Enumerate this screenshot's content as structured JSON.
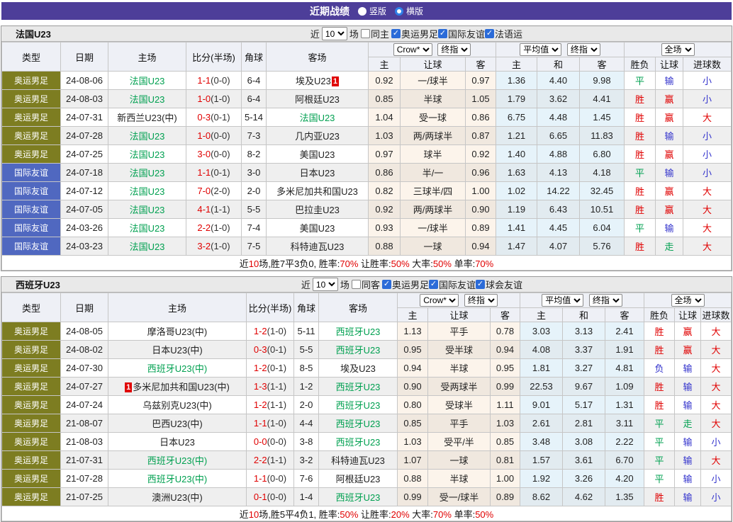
{
  "topbar": {
    "title": "近期战绩",
    "radios": [
      {
        "label": "竖版",
        "selected": false
      },
      {
        "label": "横版",
        "selected": true
      }
    ]
  },
  "colors": {
    "accent_purple": "#4d3e99",
    "red": "#e00000",
    "green": "#00a050",
    "blue": "#3333cc",
    "olive_type_badge": "#7d7d21",
    "blue_type_badge": "#5068c0",
    "header_bg": "#eef0f6",
    "section_title_bg": "#e9e9e9",
    "alt_row_bg": "#efefef",
    "odds_col_tint": "#faf0e6",
    "avg_col_tint": "#e7f2f9",
    "red_card_badge": "#e00000"
  },
  "sections": [
    {
      "team": "法国U23",
      "controls": {
        "near": "近",
        "count": "10",
        "unit": "场",
        "same": {
          "label": "同主",
          "checked": false
        },
        "filters": [
          {
            "label": "奥运男足",
            "checked": true
          },
          {
            "label": "国际友谊",
            "checked": true
          },
          {
            "label": "法语运",
            "checked": true
          }
        ]
      },
      "header": {
        "left_cols": [
          "类型",
          "日期",
          "主场",
          "比分(半场)",
          "角球",
          "客场"
        ],
        "odds_select": "Crow*",
        "odds_final_select": "终指",
        "odds_cols": [
          "主",
          "让球",
          "客"
        ],
        "avg_select": "平均值",
        "avg_final_select": "终指",
        "avg_cols": [
          "主",
          "和",
          "客"
        ],
        "full_select": "全场",
        "full_cols": [
          "胜负",
          "让球",
          "进球数"
        ]
      },
      "rows": [
        {
          "type": "奥运男足",
          "tc": "olive",
          "date": "24-08-06",
          "home": "法国U23",
          "hg": true,
          "hb": "",
          "score": "1-1",
          "half": "(0-0)",
          "corner": "6-4",
          "away": "埃及U23",
          "ag": false,
          "ab": "1",
          "o1": "0.92",
          "hc": "一/球半",
          "o2": "0.97",
          "a1": "1.36",
          "a2": "4.40",
          "a3": "9.98",
          "rs": "平",
          "rsc": "g",
          "hr": "输",
          "hrc": "b",
          "gl": "小",
          "glc": "b"
        },
        {
          "type": "奥运男足",
          "tc": "olive",
          "date": "24-08-03",
          "home": "法国U23",
          "hg": true,
          "hb": "",
          "score": "1-0",
          "half": "(1-0)",
          "corner": "6-4",
          "away": "阿根廷U23",
          "ag": false,
          "ab": "",
          "o1": "0.85",
          "hc": "半球",
          "o2": "1.05",
          "a1": "1.79",
          "a2": "3.62",
          "a3": "4.41",
          "rs": "胜",
          "rsc": "r",
          "hr": "赢",
          "hrc": "r",
          "gl": "小",
          "glc": "b"
        },
        {
          "type": "奥运男足",
          "tc": "olive",
          "date": "24-07-31",
          "home": "新西兰U23(中)",
          "hg": false,
          "hb": "",
          "score": "0-3",
          "half": "(0-1)",
          "corner": "5-14",
          "away": "法国U23",
          "ag": true,
          "ab": "",
          "o1": "1.04",
          "hc": "受一球",
          "o2": "0.86",
          "a1": "6.75",
          "a2": "4.48",
          "a3": "1.45",
          "rs": "胜",
          "rsc": "r",
          "hr": "赢",
          "hrc": "r",
          "gl": "大",
          "glc": "r"
        },
        {
          "type": "奥运男足",
          "tc": "olive",
          "date": "24-07-28",
          "home": "法国U23",
          "hg": true,
          "hb": "",
          "score": "1-0",
          "half": "(0-0)",
          "corner": "7-3",
          "away": "几内亚U23",
          "ag": false,
          "ab": "",
          "o1": "1.03",
          "hc": "两/两球半",
          "o2": "0.87",
          "a1": "1.21",
          "a2": "6.65",
          "a3": "11.83",
          "rs": "胜",
          "rsc": "r",
          "hr": "输",
          "hrc": "b",
          "gl": "小",
          "glc": "b"
        },
        {
          "type": "奥运男足",
          "tc": "olive",
          "date": "24-07-25",
          "home": "法国U23",
          "hg": true,
          "hb": "",
          "score": "3-0",
          "half": "(0-0)",
          "corner": "8-2",
          "away": "美国U23",
          "ag": false,
          "ab": "",
          "o1": "0.97",
          "hc": "球半",
          "o2": "0.92",
          "a1": "1.40",
          "a2": "4.88",
          "a3": "6.80",
          "rs": "胜",
          "rsc": "r",
          "hr": "赢",
          "hrc": "r",
          "gl": "小",
          "glc": "b"
        },
        {
          "type": "国际友谊",
          "tc": "blue",
          "date": "24-07-18",
          "home": "法国U23",
          "hg": true,
          "hb": "",
          "score": "1-1",
          "half": "(0-1)",
          "corner": "3-0",
          "away": "日本U23",
          "ag": false,
          "ab": "",
          "o1": "0.86",
          "hc": "半/一",
          "o2": "0.96",
          "a1": "1.63",
          "a2": "4.13",
          "a3": "4.18",
          "rs": "平",
          "rsc": "g",
          "hr": "输",
          "hrc": "b",
          "gl": "小",
          "glc": "b"
        },
        {
          "type": "国际友谊",
          "tc": "blue",
          "date": "24-07-12",
          "home": "法国U23",
          "hg": true,
          "hb": "",
          "score": "7-0",
          "half": "(2-0)",
          "corner": "2-0",
          "away": "多米尼加共和国U23",
          "ag": false,
          "ab": "",
          "o1": "0.82",
          "hc": "三球半/四",
          "o2": "1.00",
          "a1": "1.02",
          "a2": "14.22",
          "a3": "32.45",
          "rs": "胜",
          "rsc": "r",
          "hr": "赢",
          "hrc": "r",
          "gl": "大",
          "glc": "r"
        },
        {
          "type": "国际友谊",
          "tc": "blue",
          "date": "24-07-05",
          "home": "法国U23",
          "hg": true,
          "hb": "",
          "score": "4-1",
          "half": "(1-1)",
          "corner": "5-5",
          "away": "巴拉圭U23",
          "ag": false,
          "ab": "",
          "o1": "0.92",
          "hc": "两/两球半",
          "o2": "0.90",
          "a1": "1.19",
          "a2": "6.43",
          "a3": "10.51",
          "rs": "胜",
          "rsc": "r",
          "hr": "赢",
          "hrc": "r",
          "gl": "大",
          "glc": "r"
        },
        {
          "type": "国际友谊",
          "tc": "blue",
          "date": "24-03-26",
          "home": "法国U23",
          "hg": true,
          "hb": "",
          "score": "2-2",
          "half": "(1-0)",
          "corner": "7-4",
          "away": "美国U23",
          "ag": false,
          "ab": "",
          "o1": "0.93",
          "hc": "一/球半",
          "o2": "0.89",
          "a1": "1.41",
          "a2": "4.45",
          "a3": "6.04",
          "rs": "平",
          "rsc": "g",
          "hr": "输",
          "hrc": "b",
          "gl": "大",
          "glc": "r"
        },
        {
          "type": "国际友谊",
          "tc": "blue",
          "date": "24-03-23",
          "home": "法国U23",
          "hg": true,
          "hb": "",
          "score": "3-2",
          "half": "(1-0)",
          "corner": "7-5",
          "away": "科特迪瓦U23",
          "ag": false,
          "ab": "",
          "o1": "0.88",
          "hc": "一球",
          "o2": "0.94",
          "a1": "1.47",
          "a2": "4.07",
          "a3": "5.76",
          "rs": "胜",
          "rsc": "r",
          "hr": "走",
          "hrc": "g",
          "gl": "大",
          "glc": "r"
        }
      ],
      "summary": [
        [
          "近",
          "k"
        ],
        [
          "10",
          "r"
        ],
        [
          "场,胜7平3负0, 胜率:",
          "k"
        ],
        [
          "70%",
          "r"
        ],
        [
          " 让胜率:",
          "k"
        ],
        [
          "50%",
          "r"
        ],
        [
          " 大率:",
          "k"
        ],
        [
          "50%",
          "r"
        ],
        [
          " 单率:",
          "k"
        ],
        [
          "70%",
          "r"
        ]
      ]
    },
    {
      "team": "西班牙U23",
      "controls": {
        "near": "近",
        "count": "10",
        "unit": "场",
        "same": {
          "label": "同客",
          "checked": false
        },
        "filters": [
          {
            "label": "奥运男足",
            "checked": true
          },
          {
            "label": "国际友谊",
            "checked": true
          },
          {
            "label": "球会友谊",
            "checked": true
          }
        ]
      },
      "header": {
        "left_cols": [
          "类型",
          "日期",
          "主场",
          "比分(半场)",
          "角球",
          "客场"
        ],
        "odds_select": "Crow*",
        "odds_final_select": "终指",
        "odds_cols": [
          "主",
          "让球",
          "客"
        ],
        "avg_select": "平均值",
        "avg_final_select": "终指",
        "avg_cols": [
          "主",
          "和",
          "客"
        ],
        "full_select": "全场",
        "full_cols": [
          "胜负",
          "让球",
          "进球数"
        ]
      },
      "rows": [
        {
          "type": "奥运男足",
          "tc": "olive",
          "date": "24-08-05",
          "home": "摩洛哥U23(中)",
          "hg": false,
          "hb": "",
          "score": "1-2",
          "half": "(1-0)",
          "corner": "5-11",
          "away": "西班牙U23",
          "ag": true,
          "ab": "",
          "o1": "1.13",
          "hc": "平手",
          "o2": "0.78",
          "a1": "3.03",
          "a2": "3.13",
          "a3": "2.41",
          "rs": "胜",
          "rsc": "r",
          "hr": "赢",
          "hrc": "r",
          "gl": "大",
          "glc": "r"
        },
        {
          "type": "奥运男足",
          "tc": "olive",
          "date": "24-08-02",
          "home": "日本U23(中)",
          "hg": false,
          "hb": "",
          "score": "0-3",
          "half": "(0-1)",
          "corner": "5-5",
          "away": "西班牙U23",
          "ag": true,
          "ab": "",
          "o1": "0.95",
          "hc": "受半球",
          "o2": "0.94",
          "a1": "4.08",
          "a2": "3.37",
          "a3": "1.91",
          "rs": "胜",
          "rsc": "r",
          "hr": "赢",
          "hrc": "r",
          "gl": "大",
          "glc": "r"
        },
        {
          "type": "奥运男足",
          "tc": "olive",
          "date": "24-07-30",
          "home": "西班牙U23(中)",
          "hg": true,
          "hb": "",
          "score": "1-2",
          "half": "(0-1)",
          "corner": "8-5",
          "away": "埃及U23",
          "ag": false,
          "ab": "",
          "o1": "0.94",
          "hc": "半球",
          "o2": "0.95",
          "a1": "1.81",
          "a2": "3.27",
          "a3": "4.81",
          "rs": "负",
          "rsc": "b",
          "hr": "输",
          "hrc": "b",
          "gl": "大",
          "glc": "r"
        },
        {
          "type": "奥运男足",
          "tc": "olive",
          "date": "24-07-27",
          "home": "多米尼加共和国U23(中)",
          "hg": false,
          "hb": "1",
          "score": "1-3",
          "half": "(1-1)",
          "corner": "1-2",
          "away": "西班牙U23",
          "ag": true,
          "ab": "",
          "o1": "0.90",
          "hc": "受两球半",
          "o2": "0.99",
          "a1": "22.53",
          "a2": "9.67",
          "a3": "1.09",
          "rs": "胜",
          "rsc": "r",
          "hr": "输",
          "hrc": "b",
          "gl": "大",
          "glc": "r"
        },
        {
          "type": "奥运男足",
          "tc": "olive",
          "date": "24-07-24",
          "home": "乌兹别克U23(中)",
          "hg": false,
          "hb": "",
          "score": "1-2",
          "half": "(1-1)",
          "corner": "2-0",
          "away": "西班牙U23",
          "ag": true,
          "ab": "",
          "o1": "0.80",
          "hc": "受球半",
          "o2": "1.11",
          "a1": "9.01",
          "a2": "5.17",
          "a3": "1.31",
          "rs": "胜",
          "rsc": "r",
          "hr": "输",
          "hrc": "b",
          "gl": "大",
          "glc": "r"
        },
        {
          "type": "奥运男足",
          "tc": "olive",
          "date": "21-08-07",
          "home": "巴西U23(中)",
          "hg": false,
          "hb": "",
          "score": "1-1",
          "half": "(1-0)",
          "corner": "4-4",
          "away": "西班牙U23",
          "ag": true,
          "ab": "",
          "o1": "0.85",
          "hc": "平手",
          "o2": "1.03",
          "a1": "2.61",
          "a2": "2.81",
          "a3": "3.11",
          "rs": "平",
          "rsc": "g",
          "hr": "走",
          "hrc": "g",
          "gl": "大",
          "glc": "r"
        },
        {
          "type": "奥运男足",
          "tc": "olive",
          "date": "21-08-03",
          "home": "日本U23",
          "hg": false,
          "hb": "",
          "score": "0-0",
          "half": "(0-0)",
          "corner": "3-8",
          "away": "西班牙U23",
          "ag": true,
          "ab": "",
          "o1": "1.03",
          "hc": "受平/半",
          "o2": "0.85",
          "a1": "3.48",
          "a2": "3.08",
          "a3": "2.22",
          "rs": "平",
          "rsc": "g",
          "hr": "输",
          "hrc": "b",
          "gl": "小",
          "glc": "b"
        },
        {
          "type": "奥运男足",
          "tc": "olive",
          "date": "21-07-31",
          "home": "西班牙U23(中)",
          "hg": true,
          "hb": "",
          "score": "2-2",
          "half": "(1-1)",
          "corner": "3-2",
          "away": "科特迪瓦U23",
          "ag": false,
          "ab": "",
          "o1": "1.07",
          "hc": "一球",
          "o2": "0.81",
          "a1": "1.57",
          "a2": "3.61",
          "a3": "6.70",
          "rs": "平",
          "rsc": "g",
          "hr": "输",
          "hrc": "b",
          "gl": "大",
          "glc": "r"
        },
        {
          "type": "奥运男足",
          "tc": "olive",
          "date": "21-07-28",
          "home": "西班牙U23(中)",
          "hg": true,
          "hb": "",
          "score": "1-1",
          "half": "(0-0)",
          "corner": "7-6",
          "away": "阿根廷U23",
          "ag": false,
          "ab": "",
          "o1": "0.88",
          "hc": "半球",
          "o2": "1.00",
          "a1": "1.92",
          "a2": "3.26",
          "a3": "4.20",
          "rs": "平",
          "rsc": "g",
          "hr": "输",
          "hrc": "b",
          "gl": "小",
          "glc": "b"
        },
        {
          "type": "奥运男足",
          "tc": "olive",
          "date": "21-07-25",
          "home": "澳洲U23(中)",
          "hg": false,
          "hb": "",
          "score": "0-1",
          "half": "(0-0)",
          "corner": "1-4",
          "away": "西班牙U23",
          "ag": true,
          "ab": "",
          "o1": "0.99",
          "hc": "受一/球半",
          "o2": "0.89",
          "a1": "8.62",
          "a2": "4.62",
          "a3": "1.35",
          "rs": "胜",
          "rsc": "r",
          "hr": "输",
          "hrc": "b",
          "gl": "小",
          "glc": "b"
        }
      ],
      "summary": [
        [
          "近",
          "k"
        ],
        [
          "10",
          "r"
        ],
        [
          "场,胜5平4负1, 胜率:",
          "k"
        ],
        [
          "50%",
          "r"
        ],
        [
          " 让胜率:",
          "k"
        ],
        [
          "20%",
          "r"
        ],
        [
          " 大率:",
          "k"
        ],
        [
          "70%",
          "r"
        ],
        [
          " 单率:",
          "k"
        ],
        [
          "50%",
          "r"
        ]
      ]
    }
  ]
}
